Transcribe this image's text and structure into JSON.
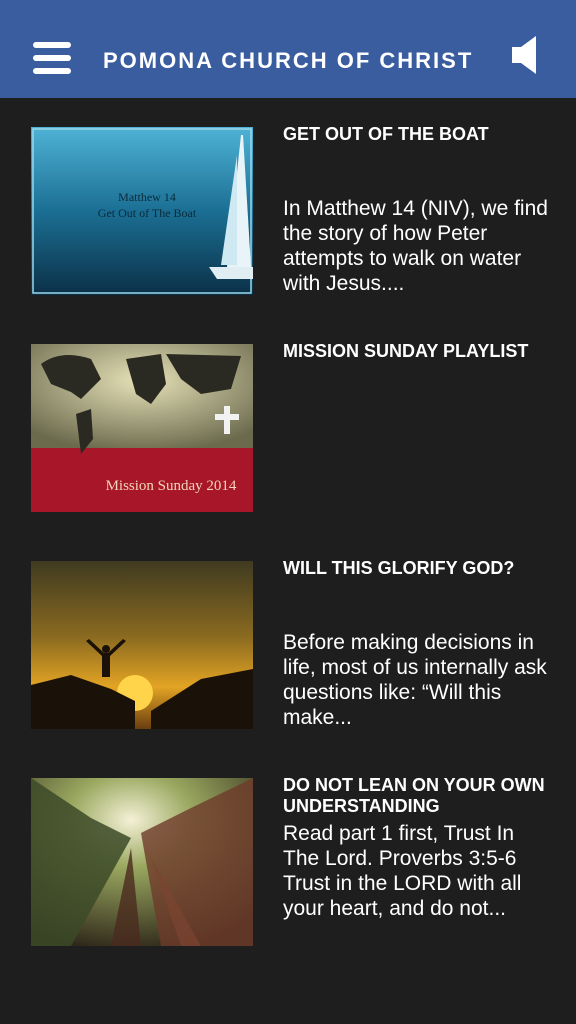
{
  "header": {
    "title": "POMONA CHURCH OF CHRIST",
    "menu_icon": "hamburger-menu-icon",
    "audio_icon": "speaker-icon",
    "bg_color": "#3a5d9f"
  },
  "items": [
    {
      "title": "GET OUT OF THE BOAT",
      "description": "In Matthew 14 (NIV), we find the story of how Peter attempts to walk on water with Jesus....",
      "thumb_text": [
        "Matthew 14",
        "Get Out of The Boat"
      ]
    },
    {
      "title": "MISSION SUNDAY PLAYLIST",
      "description": "",
      "thumb_text": [
        "Mission Sunday 2014"
      ]
    },
    {
      "title": "WILL THIS GLORIFY GOD?",
      "description": "Before making decisions in life, most of us internally ask questions like:  “Will this make...",
      "thumb_text": []
    },
    {
      "title": "DO NOT LEAN ON YOUR OWN UNDERSTANDING",
      "description": "Read part 1 first, Trust In The Lord. Proverbs 3:5-6 Trust in the LORD with all your heart, and do not...",
      "thumb_text": []
    }
  ]
}
